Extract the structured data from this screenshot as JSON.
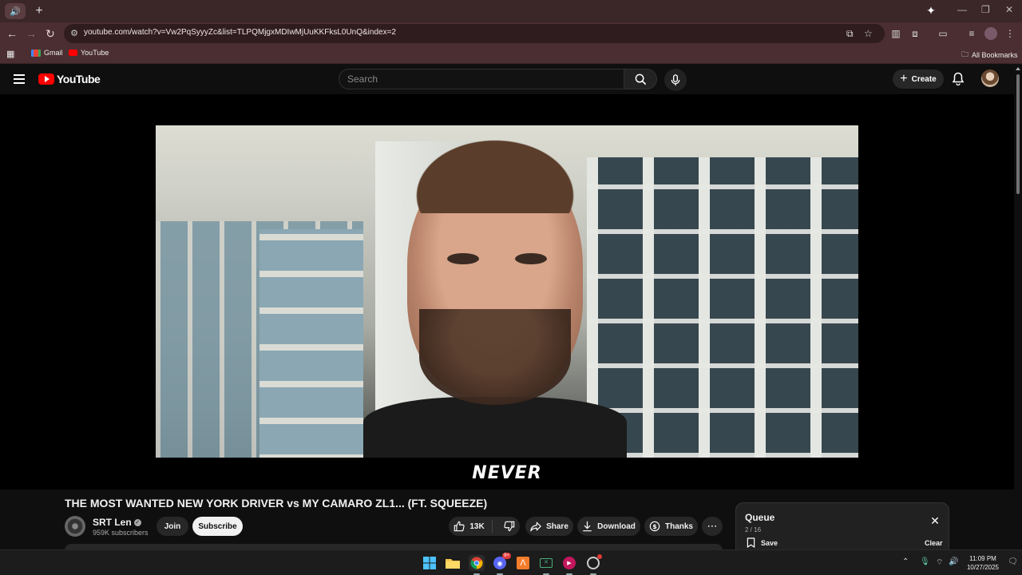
{
  "browser": {
    "url": "youtube.com/watch?v=Vw2PqSyyyZc&list=TLPQMjgxMDIwMjUuKKFksL0UnQ&index=2",
    "bookmarks": [
      {
        "label": "Gmail",
        "icon": "gmail-icon"
      },
      {
        "label": "YouTube",
        "icon": "youtube-icon"
      }
    ],
    "all_bookmarks_label": "All Bookmarks"
  },
  "header": {
    "logo_text": "YouTube",
    "search_placeholder": "Search",
    "create_label": "Create"
  },
  "video": {
    "subtitle_text": "NEVER",
    "title": "THE MOST WANTED NEW YORK DRIVER vs MY CAMARO ZL1... (FT. SQUEEZE)"
  },
  "channel": {
    "name": "SRT Len",
    "subscribers": "959K subscribers",
    "join_label": "Join",
    "subscribe_label": "Subscribe"
  },
  "actions": {
    "likes": "13K",
    "share_label": "Share",
    "download_label": "Download",
    "thanks_label": "Thanks"
  },
  "queue": {
    "title": "Queue",
    "position": "2 / 16",
    "save_label": "Save",
    "clear_label": "Clear"
  },
  "taskbar": {
    "time": "11:09 PM",
    "date": "10/27/2025",
    "discord_badge": "9+"
  },
  "colors": {
    "brand_red": "#ff0000",
    "chrome_frame": "#4a2e31",
    "yt_background": "#0f0f0f",
    "pill_background": "#272727"
  }
}
